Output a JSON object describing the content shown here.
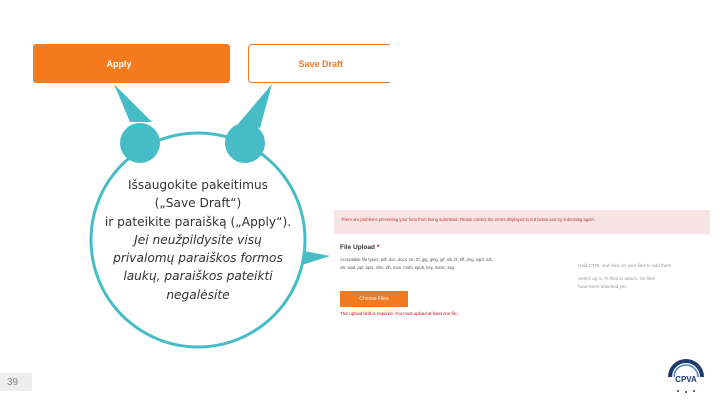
{
  "buttons": {
    "apply_label": "Apply",
    "save_draft_label": "Save Draft"
  },
  "callout": {
    "lines": [
      "Išsaugokite pakeitimus",
      "(„Save Draft“)",
      "ir pateikite paraišką („Apply“).",
      "Jei neužpildysite visų",
      "privalomų paraiškos formos",
      "laukų, paraiškos pateikti",
      "negalėsite"
    ]
  },
  "form": {
    "error_banner": "There are problems preventing your form from being submitted. Please correct the errors displayed in red below and try submitting again.",
    "upload_label": "File Upload",
    "required_mark": "*",
    "accepted_types_line1": "Acceptable file types: pdf, doc, docx, txt, rtf, jpg, jpeg, gif, xls, tif, tiff, png, wpd, odt,",
    "accepted_types_line2": "xls, wpd, ppt, pptx, xlsx, xlb, mus, mobi, epub, key, numc, svg.",
    "choose_files_label": "Choose Files",
    "upload_error": "This upload field is required. You must upload at least one file.",
    "side_hint": "Hold CTRL and click on your files to add them.",
    "side_limit_1": "Select up to 75 files to attach. No files",
    "side_limit_2": "have been attached yet."
  },
  "footer": {
    "slide_number": "39",
    "logo_text": "CPVA"
  },
  "colors": {
    "accent": "#f47a1f",
    "callout_teal": "#45bcc6",
    "error_red": "#d0021b",
    "error_bg": "#f6e3e3"
  }
}
